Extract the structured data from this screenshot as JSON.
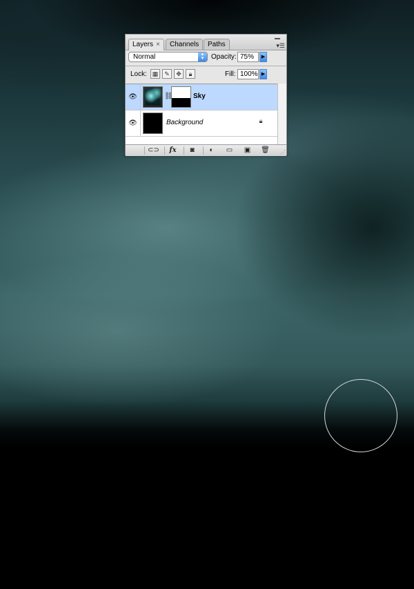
{
  "layers_panel": {
    "tabs": [
      {
        "label": "Layers",
        "close": "×"
      },
      {
        "label": "Channels"
      },
      {
        "label": "Paths"
      }
    ],
    "blend_mode": "Normal",
    "opacity_label": "Opacity:",
    "opacity_value": "75%",
    "lock_label": "Lock:",
    "fill_label": "Fill:",
    "fill_value": "100%",
    "layers": [
      {
        "name": "Sky",
        "selected": true,
        "visible": true,
        "has_mask": true
      },
      {
        "name": "Background",
        "selected": false,
        "visible": true,
        "locked": true
      }
    ],
    "bottom_icons": [
      "link-layers-icon",
      "fx-icon",
      "add-mask-icon",
      "adjustment-layer-icon",
      "new-group-icon",
      "new-layer-icon",
      "trash-icon"
    ],
    "fx_label": "fx"
  },
  "colors": {
    "selection": "#bdd9ff",
    "accent": "#3d8ae6"
  }
}
